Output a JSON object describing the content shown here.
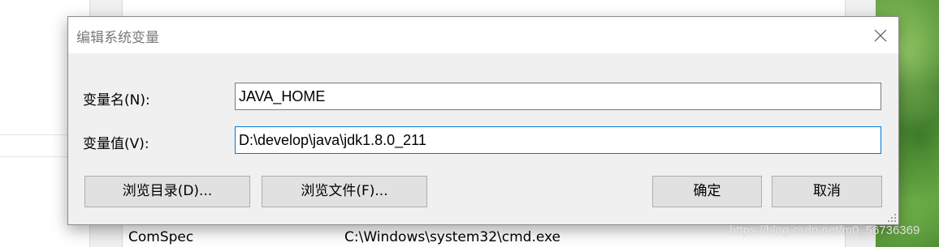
{
  "dialog": {
    "title": "编辑系统变量",
    "name_label": "变量名(N):",
    "name_value": "JAVA_HOME",
    "value_label": "变量值(V):",
    "value_value": "D:\\develop\\java\\jdk1.8.0_211",
    "browse_dir_label": "浏览目录(D)...",
    "browse_file_label": "浏览文件(F)...",
    "ok_label": "确定",
    "cancel_label": "取消"
  },
  "background": {
    "row": {
      "name": "ComSpec",
      "value": "C:\\Windows\\system32\\cmd.exe"
    }
  },
  "watermark": "https://blog.csdn.net/m0_56736369",
  "icons": {
    "close": "close-icon",
    "resize": "resize-grip-icon"
  },
  "colors": {
    "focus_border": "#0078d7",
    "button_bg": "#e1e1e1",
    "dialog_bg": "#f0f0f0"
  }
}
